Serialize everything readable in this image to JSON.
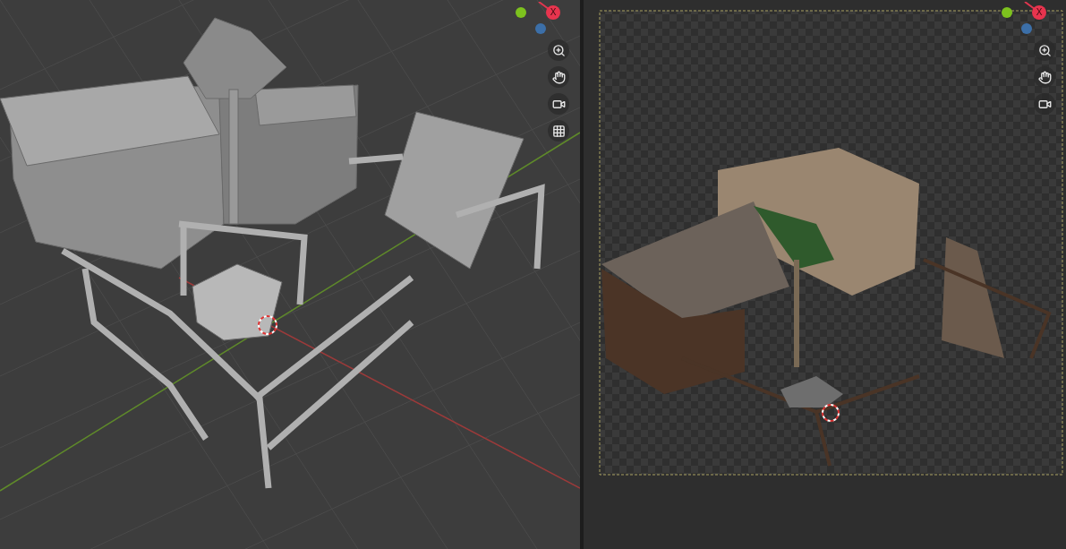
{
  "viewports": [
    {
      "kind": "solid",
      "gizmo": {
        "x_label": "X"
      },
      "nav_buttons": [
        {
          "kind": "zoom"
        },
        {
          "kind": "pan"
        },
        {
          "kind": "camera"
        },
        {
          "kind": "ortho"
        }
      ]
    },
    {
      "kind": "rendered",
      "gizmo": {
        "x_label": "X"
      },
      "nav_buttons": [
        {
          "kind": "zoom"
        },
        {
          "kind": "pan"
        },
        {
          "kind": "camera"
        }
      ]
    }
  ]
}
